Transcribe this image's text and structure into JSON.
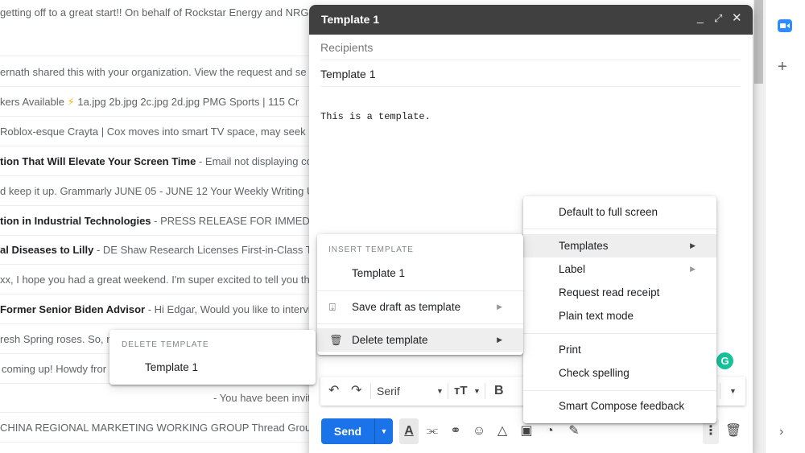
{
  "mail_list": {
    "rows": [
      {
        "subject": "",
        "snippet": "getting off to a great start!! On behalf of Rockstar Energy and NRG"
      },
      {
        "subject": "",
        "snippet": "ernath shared this with your organization. View the request and se"
      },
      {
        "subject": "",
        "snippet_pre": "kers Available ",
        "bolt": "⚡",
        "snippet": " 1a.jpg 2b.jpg 2c.jpg 2d.jpg PMG Sports | 115 Cr"
      },
      {
        "subject": "",
        "snippet": "Roblox-esque Crayta | Cox moves into smart TV space, may seek p"
      },
      {
        "subject": "tion That Will Elevate Your Screen Time",
        "snippet": " - Email not displaying cor"
      },
      {
        "subject": "",
        "snippet": "d keep it up. Grammarly JUNE 05 - JUNE 12 Your Weekly Writing Up"
      },
      {
        "subject": "tion in Industrial Technologies",
        "snippet": " - PRESS RELEASE FOR IMMEDIATE"
      },
      {
        "subject": "al Diseases to Lilly",
        "snippet": " - DE Shaw Research Licenses First-in-Class The"
      },
      {
        "subject": "",
        "snippet": "xx, I hope you had a great weekend. I'm super excited to tell you th"
      },
      {
        "subject": "Former Senior Biden Advisor",
        "snippet": " - Hi Edgar, Would you like to intervie"
      },
      {
        "subject": "",
        "snippet": "resh Spring roses. So, n"
      },
      {
        "subject": "",
        "snippet": "coming up! Howdy fror"
      },
      {
        "subject": "",
        "snippet": "- You have been invit"
      },
      {
        "subject": "",
        "snippet": "CHINA REGIONAL MARKETING WORKING GROUP Thread Group is"
      }
    ]
  },
  "compose": {
    "title": "Template 1",
    "header_buttons": {
      "minimize": "minimize-icon",
      "fullscreen": "fullscreen-icon",
      "close": "close-icon"
    },
    "recipients_placeholder": "Recipients",
    "subject": "Template 1",
    "body": "This is a template.",
    "toolbar": {
      "undo": "↶",
      "redo": "↷",
      "font": "Serif",
      "size": "тT",
      "bold": "B"
    },
    "send_label": "Send"
  },
  "menus": {
    "more_options": {
      "items": [
        {
          "label": "Default to full screen"
        },
        {
          "label": "Templates",
          "submenu": true
        },
        {
          "label": "Label",
          "submenu": true
        },
        {
          "label": "Request read receipt"
        },
        {
          "label": "Plain text mode"
        },
        {
          "label": "Print"
        },
        {
          "label": "Check spelling"
        },
        {
          "label": "Smart Compose feedback"
        }
      ]
    },
    "templates": {
      "heading": "INSERT TEMPLATE",
      "template_item": "Template 1",
      "save_draft": "Save draft as template",
      "delete": "Delete template"
    },
    "delete_templates": {
      "heading": "DELETE TEMPLATE",
      "template_item": "Template 1"
    }
  },
  "sidebar": {
    "apps": [
      {
        "name": "zoom",
        "icon": "zoom-icon"
      },
      {
        "name": "add",
        "icon": "plus-icon"
      }
    ],
    "expand_icon": "›"
  }
}
